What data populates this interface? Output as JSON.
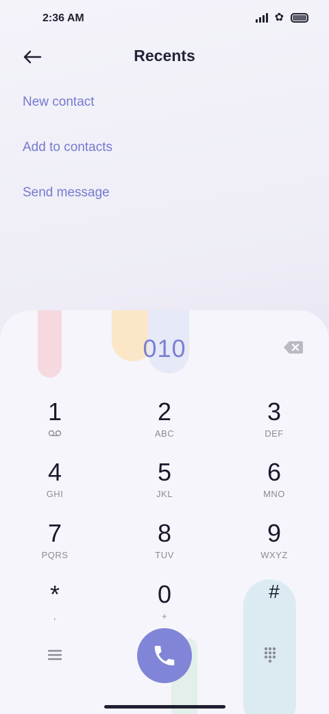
{
  "status_bar": {
    "time": "2:36 AM",
    "icons": [
      "signal-icon",
      "star-icon",
      "battery-icon"
    ]
  },
  "header": {
    "title": "Recents",
    "back_icon": "back-arrow-icon"
  },
  "options": [
    {
      "label": "New contact"
    },
    {
      "label": "Add to contacts"
    },
    {
      "label": "Send message"
    }
  ],
  "dialer": {
    "number": "010",
    "keys": [
      {
        "digit": "1",
        "letters": ""
      },
      {
        "digit": "2",
        "letters": "ABC"
      },
      {
        "digit": "3",
        "letters": "DEF"
      },
      {
        "digit": "4",
        "letters": "GHI"
      },
      {
        "digit": "5",
        "letters": "JKL"
      },
      {
        "digit": "6",
        "letters": "MNO"
      },
      {
        "digit": "7",
        "letters": "PQRS"
      },
      {
        "digit": "8",
        "letters": "TUV"
      },
      {
        "digit": "9",
        "letters": "WXYZ"
      },
      {
        "digit": "*",
        "letters": ","
      },
      {
        "digit": "0",
        "letters": "+"
      },
      {
        "digit": "#",
        "letters": ""
      }
    ],
    "key_icons": {
      "1": "voicemail-icon"
    },
    "bottom_icons": [
      "menu-icon",
      "phone-icon",
      "dialpad-icon"
    ]
  },
  "colors": {
    "accent": "#8185d8",
    "option_text": "#7479cf",
    "number_text": "#7b80cf",
    "dialer_bg": "#f6f5fb"
  }
}
